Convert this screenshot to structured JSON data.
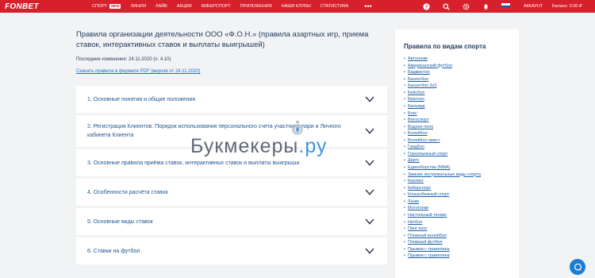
{
  "header": {
    "logo": "FONBET",
    "nav": [
      {
        "label": "СПОРТ",
        "badge": "NEW"
      },
      {
        "label": "ЛИНИЯ"
      },
      {
        "label": "ЛАЙВ"
      },
      {
        "label": "АКЦИИ"
      },
      {
        "label": "КИБЕРСПОРТ"
      },
      {
        "label": "ПРИЛОЖЕНИЯ"
      },
      {
        "label": "НАШИ КЛУБЫ"
      },
      {
        "label": "СТАТИСТИКА"
      }
    ],
    "more": "•••",
    "account": "АККАУНТ",
    "balance": "Баланс: 0.00 ₽",
    "brand_color": "#d6202b"
  },
  "main": {
    "title": "Правила организации деятельности ООО «Ф.О.Н.» (правила азартных игр, приема ставок, интерактивных ставок и выплаты выигрышей)",
    "last_modified": "Последние изменения: 24.11.2020 (п. 4.10)",
    "pdf_link": "Скачать правила в формате PDF (версия от 24.11.2020)",
    "sections": [
      "1. Основные понятия и общие положения",
      "2. Регистрация Клиентов. Порядок использования персонального счета участника пари и Личного кабинета Клиента",
      "3. Основные правила приёма ставок, интерактивных ставок и выплаты выигрыша",
      "4. Особенности расчёта ставок",
      "5. Основные виды ставок",
      "6. Ставки на футбол"
    ]
  },
  "sidebar": {
    "title": "Правила по видам спорта",
    "items": [
      "Автогонки",
      "Американский футбол",
      "Бадминтон",
      "Баскетбол",
      "Баскетбол 3х3",
      "Бейсбол",
      "Биатлон",
      "Бильярд",
      "Бокс",
      "Велоспорт",
      "Водное поло",
      "Волейбол",
      "Волейбол микст",
      "Гандбол",
      "Горнолыжный спорт",
      "Дартс",
      "Единоборства (ММА)",
      "Зимние экстремальные виды спорта",
      "Керлинг",
      "Киберспорт",
      "Конькобежный спорт",
      "Лыжи",
      "Мотогонки",
      "Настольный теннис",
      "Нетбол",
      "Пинг-понг",
      "Пляжный волейбол",
      "Пляжный футбол",
      "Прыжки с трамплина",
      "Прыжки с трамплина"
    ]
  },
  "watermark": {
    "text": "Букмекеры",
    "suffix": ".ру"
  }
}
